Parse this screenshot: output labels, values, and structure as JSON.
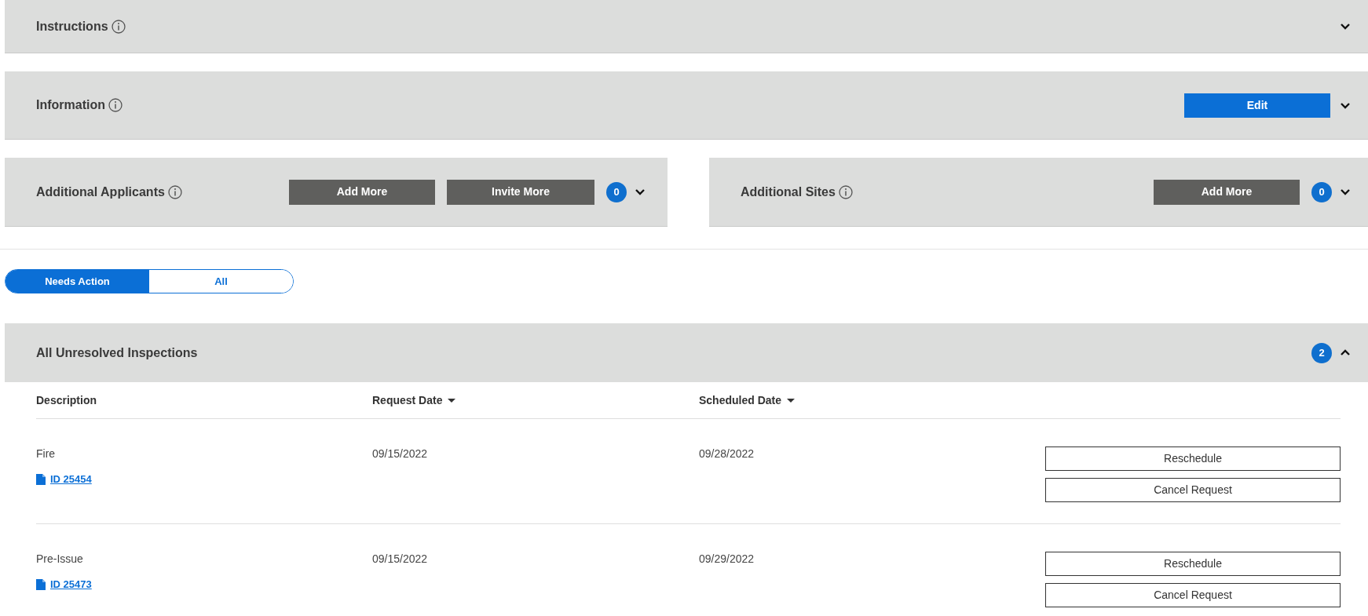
{
  "sections": [
    {
      "title": "Instructions",
      "expanded": false
    },
    {
      "title": "Information",
      "expanded": false,
      "edit_button": "Edit"
    }
  ],
  "side_panels": [
    {
      "title": "Additional Applicants",
      "buttons": [
        "Add More",
        "Invite More"
      ],
      "count": "0",
      "expanded": false
    },
    {
      "title": "Additional Sites",
      "buttons": [
        "Add More"
      ],
      "count": "0",
      "expanded": false
    }
  ],
  "filter_tabs": [
    {
      "label": "Needs Action",
      "selected": true
    },
    {
      "label": "All",
      "selected": false
    }
  ],
  "inspections": {
    "title": "All Unresolved Inspections",
    "count": "2",
    "expanded": true,
    "columns": [
      {
        "label": "Description",
        "sortable": false
      },
      {
        "label": "Request Date",
        "sortable": true
      },
      {
        "label": "Scheduled Date",
        "sortable": true
      }
    ],
    "rows": [
      {
        "description": "Fire",
        "id_link": "ID 25454",
        "request_date": "09/15/2022",
        "scheduled_date": "09/28/2022",
        "actions": [
          "Reschedule",
          "Cancel Request"
        ]
      },
      {
        "description": "Pre-Issue",
        "id_link": "ID 25473",
        "request_date": "09/15/2022",
        "scheduled_date": "09/29/2022",
        "actions": [
          "Reschedule",
          "Cancel Request"
        ]
      }
    ]
  }
}
